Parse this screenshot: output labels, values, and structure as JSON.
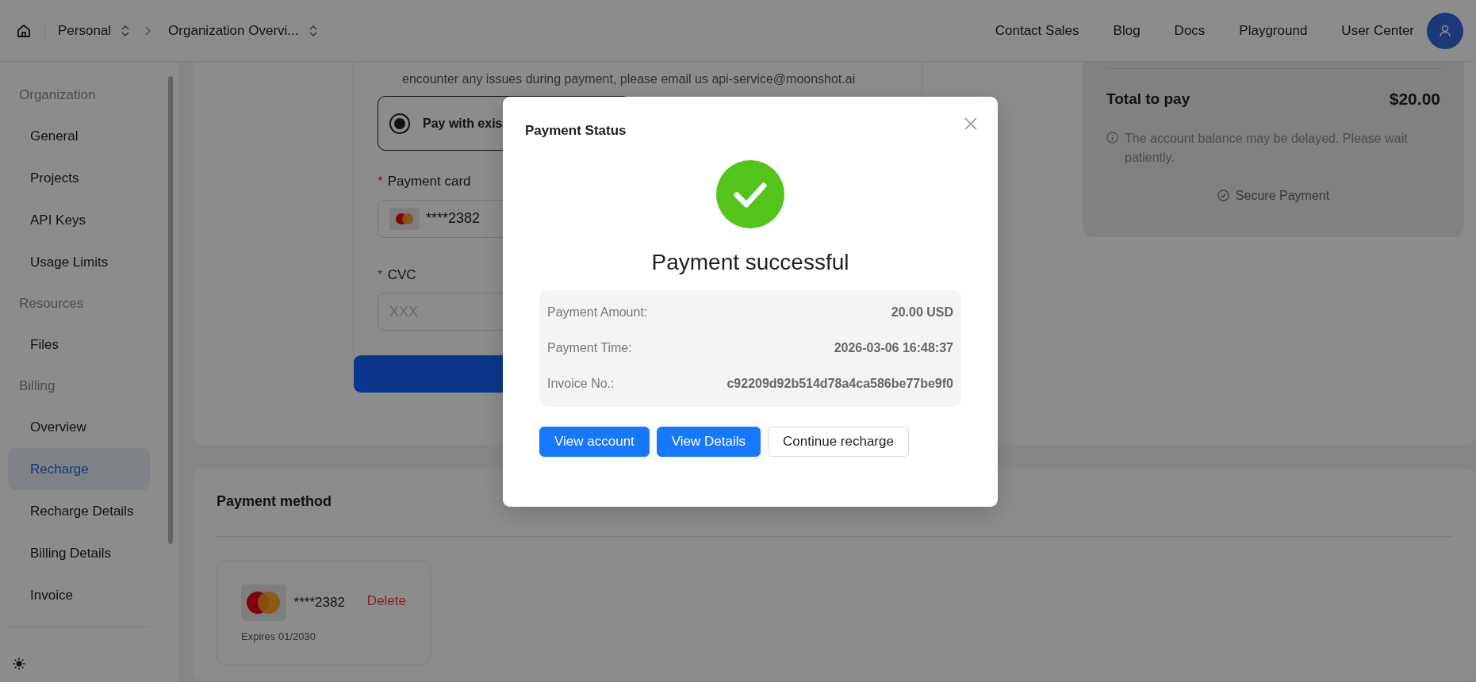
{
  "header": {
    "breadcrumbs": [
      {
        "label": "Personal"
      },
      {
        "label": "Organization Overvi..."
      }
    ],
    "links": [
      "Contact Sales",
      "Blog",
      "Docs",
      "Playground",
      "User Center"
    ]
  },
  "sidebar": {
    "sections": [
      {
        "title": "Organization",
        "items": [
          {
            "label": "General",
            "selected": false
          },
          {
            "label": "Projects",
            "selected": false
          },
          {
            "label": "API Keys",
            "selected": false
          },
          {
            "label": "Usage Limits",
            "selected": false
          }
        ]
      },
      {
        "title": "Resources",
        "items": [
          {
            "label": "Files",
            "selected": false
          }
        ]
      },
      {
        "title": "Billing",
        "items": [
          {
            "label": "Overview",
            "selected": false
          },
          {
            "label": "Recharge",
            "selected": true
          },
          {
            "label": "Recharge Details",
            "selected": false
          },
          {
            "label": "Billing Details",
            "selected": false
          },
          {
            "label": "Invoice",
            "selected": false
          }
        ]
      }
    ]
  },
  "recharge_form": {
    "notice": "encounter any issues during payment, please email us api-service@moonshot.ai",
    "payment_options": [
      {
        "label": "Pay with exis",
        "selected": true
      }
    ],
    "card_field": {
      "required_mark": "*",
      "label": "Payment card",
      "value": "****2382"
    },
    "cvc_field": {
      "required_mark": "*",
      "label": "CVC",
      "placeholder": "XXX"
    }
  },
  "summary": {
    "total_label": "Total to pay",
    "total": "$20.00",
    "note": "The account balance may be delayed. Please wait patiently.",
    "secure": "Secure Payment"
  },
  "payment_methods": {
    "title": "Payment method",
    "cards": [
      {
        "number": "****2382",
        "action": "Delete",
        "expires": "Expires 01/2030"
      }
    ]
  },
  "modal": {
    "title": "Payment Status",
    "success": true,
    "message": "Payment successful",
    "details": [
      {
        "label": "Payment Amount:",
        "value": "20.00 USD"
      },
      {
        "label": "Payment Time:",
        "value": "2026-03-06 16:48:37"
      },
      {
        "label": "Invoice No.:",
        "value": "c92209d92b514d78a4ca586be77be9f0"
      }
    ],
    "buttons": [
      {
        "label": "View account",
        "kind": "primary"
      },
      {
        "label": "View Details",
        "kind": "primary"
      },
      {
        "label": "Continue recharge",
        "kind": "default"
      }
    ]
  }
}
